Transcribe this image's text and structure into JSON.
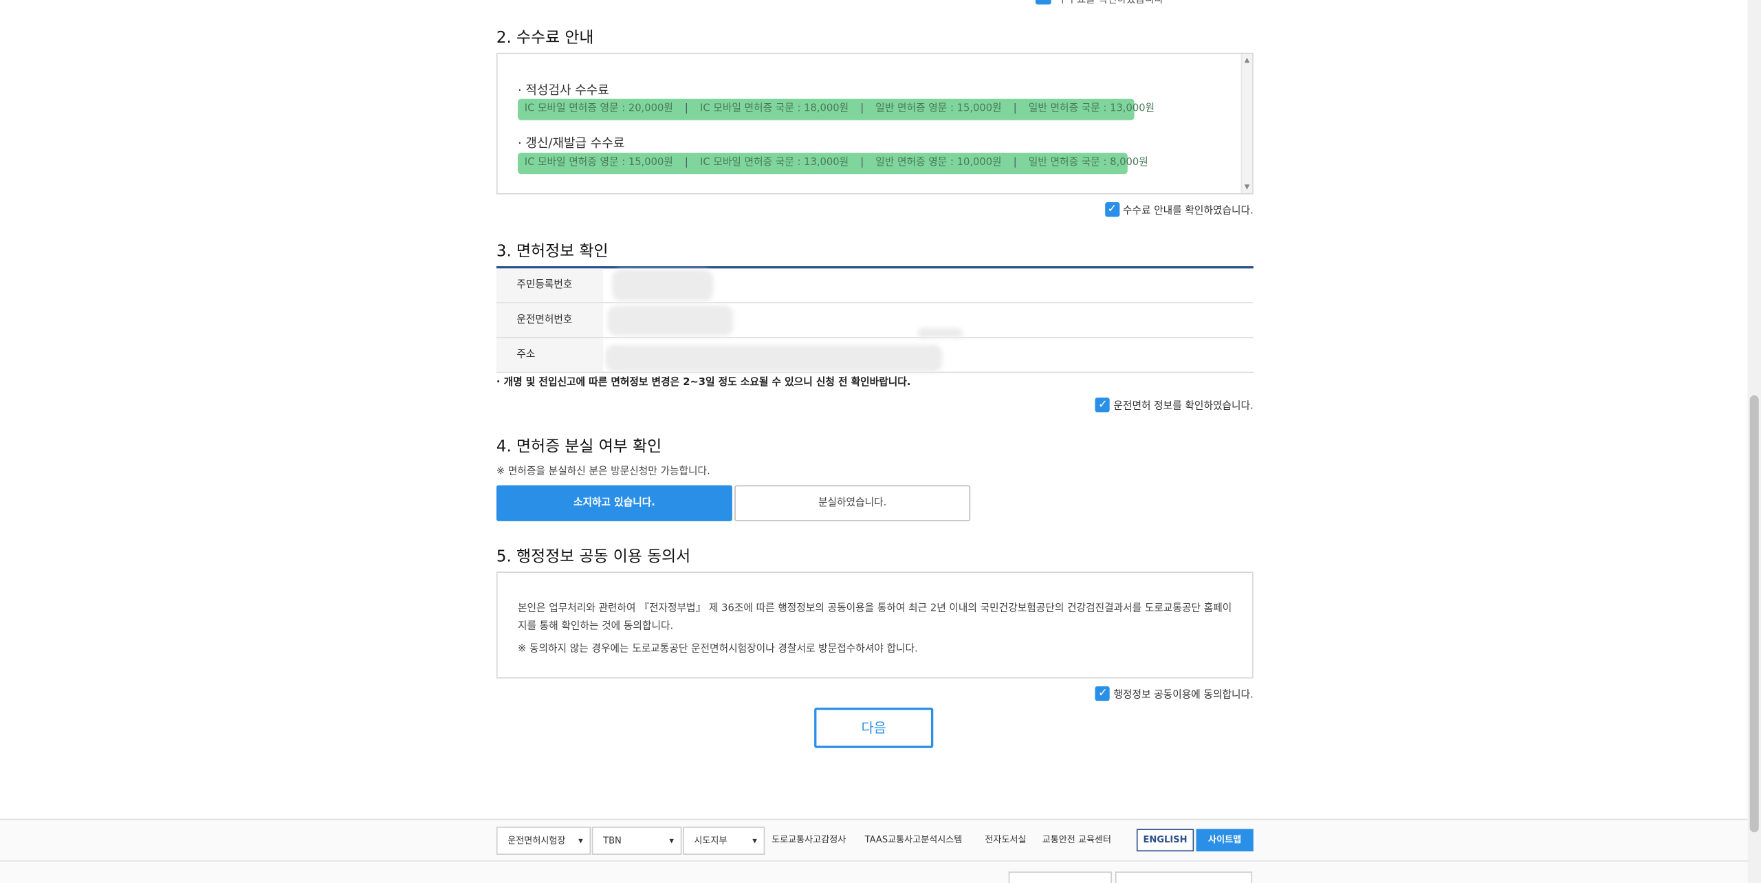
{
  "top_partial": {
    "text": "수수료를 확인하였습니다"
  },
  "section2": {
    "title": "2. 수수료 안내",
    "aptitude_label": "· 적성검사 수수료",
    "aptitude_fees": [
      "IC 모바일 면허증 영문 : 20,000원",
      "IC 모바일 면허증 국문 : 18,000원",
      "일반 면허증 영문 : 15,000원",
      "일반 면허증 국문 : 13,000원"
    ],
    "renew_label": "· 갱신/재발급 수수료",
    "renew_fees": [
      "IC 모바일 면허증 영문 : 15,000원",
      "IC 모바일 면허증 국문 : 13,000원",
      "일반 면허증 영문 : 10,000원",
      "일반 면허증 국문 : 8,000원"
    ],
    "separator": "|",
    "confirm": "수수료 안내를 확인하였습니다."
  },
  "section3": {
    "title": "3. 면허정보 확인",
    "rows": [
      "주민등록번호",
      "운전면허번호",
      "주소"
    ],
    "note": "· 개명 및 전입신고에 따른 면허정보 변경은 2~3일 정도 소요될 수 있으니 신청 전 확인바랍니다.",
    "confirm": "운전면허 정보를 확인하였습니다."
  },
  "section4": {
    "title": "4. 면허증 분실 여부 확인",
    "note": "※ 면허증을 분실하신 분은 방문신청만 가능합니다.",
    "own_button": "소지하고 있습니다.",
    "lost_button": "분실하였습니다."
  },
  "section5": {
    "title": "5. 행정정보 공동 이용 동의서",
    "body": "본인은 업무처리와 관련하여 『전자정부법』 제 36조에 따른 행정정보의 공동이용을 통하여 최근 2년 이내의 국민건강보험공단의 건강검진결과서를 도로교통공단 홈페이지를 통해 확인하는 것에 동의합니다.",
    "notice": "※ 동의하지 않는 경우에는 도로교통공단 운전면허시험장이나 경찰서로 방문접수하셔야 합니다.",
    "confirm": "행정정보 공동이용에 동의합니다."
  },
  "next_button": "다음",
  "footer": {
    "selects": [
      "운전면허시험장",
      "TBN",
      "시도지부"
    ],
    "links": [
      "도로교통사고감정사",
      "TAAS교통사고분석시스템",
      "전자도서실",
      "교통안전 교육센터"
    ],
    "english": "ENGLISH",
    "sitemap": "사이트맵"
  },
  "colors": {
    "accent": "#2a8fe6",
    "highlight": "#7fd59c",
    "table_border": "#2b4f8a"
  }
}
